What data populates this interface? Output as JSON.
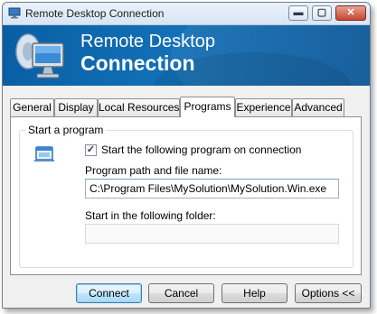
{
  "window": {
    "title": "Remote Desktop Connection"
  },
  "caption_buttons": {
    "minimize": "▬",
    "maximize": "▢",
    "close": "✕"
  },
  "banner": {
    "line1": "Remote Desktop",
    "line2": "Connection"
  },
  "tabs": [
    {
      "label": "General",
      "active": false
    },
    {
      "label": "Display",
      "active": false
    },
    {
      "label": "Local Resources",
      "active": false
    },
    {
      "label": "Programs",
      "active": true
    },
    {
      "label": "Experience",
      "active": false
    },
    {
      "label": "Advanced",
      "active": false
    }
  ],
  "programs": {
    "group_label": "Start a program",
    "start_checkbox": {
      "label": "Start the following program on connection",
      "checked": true,
      "check_glyph": "✓"
    },
    "path_label": "Program path and file name:",
    "path_value": "C:\\Program Files\\MySolution\\MySolution.Win.exe",
    "folder_label": "Start in the following folder:",
    "folder_value": ""
  },
  "buttons": {
    "connect": "Connect",
    "cancel": "Cancel",
    "help": "Help",
    "options": "Options <<"
  },
  "colors": {
    "banner": "#1270b6",
    "title_bar": "#d8e5f3",
    "dialog_bg": "#f0f0f0",
    "default_button": "#bee6fd"
  }
}
